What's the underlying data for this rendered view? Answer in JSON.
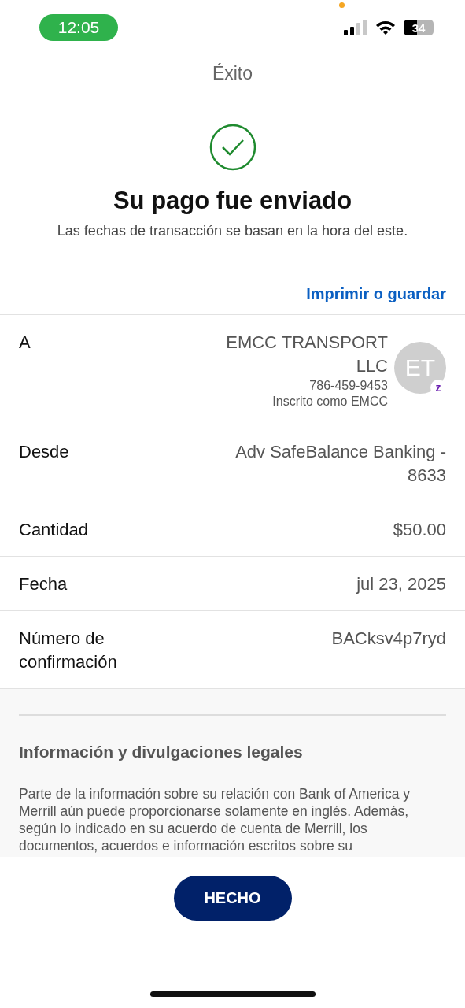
{
  "status_bar": {
    "time": "12:05",
    "battery": "34"
  },
  "header": {
    "title": "Éxito"
  },
  "confirmation": {
    "heading": "Su pago fue enviado",
    "subtitle": "Las fechas de transacción se basan en la hora del este."
  },
  "print_link": "Imprimir o guardar",
  "details": [
    {
      "kind": "payee",
      "label": "A",
      "value": "EMCC TRANSPORT LLC",
      "phone": "786-459-9453",
      "enrolled": "Inscrito como EMCC",
      "initials": "ET",
      "badge": "z"
    },
    {
      "kind": "plain",
      "label": "Desde",
      "value": "Adv SafeBalance Banking - 8633"
    },
    {
      "kind": "plain",
      "label": "Cantidad",
      "value": "$50.00"
    },
    {
      "kind": "plain",
      "label": "Fecha",
      "value": "jul 23, 2025"
    },
    {
      "kind": "plain",
      "label": "Número de confirmación",
      "value": "BACksv4p7ryd"
    }
  ],
  "legal": {
    "heading": "Información y divulgaciones legales",
    "text": "Parte de la información sobre su relación con Bank of America y Merrill aún puede proporcionarse solamente en inglés. Además, según lo indicado en su acuerdo de cuenta de Merrill, los documentos, acuerdos e información escritos sobre su"
  },
  "done_button": "HECHO"
}
